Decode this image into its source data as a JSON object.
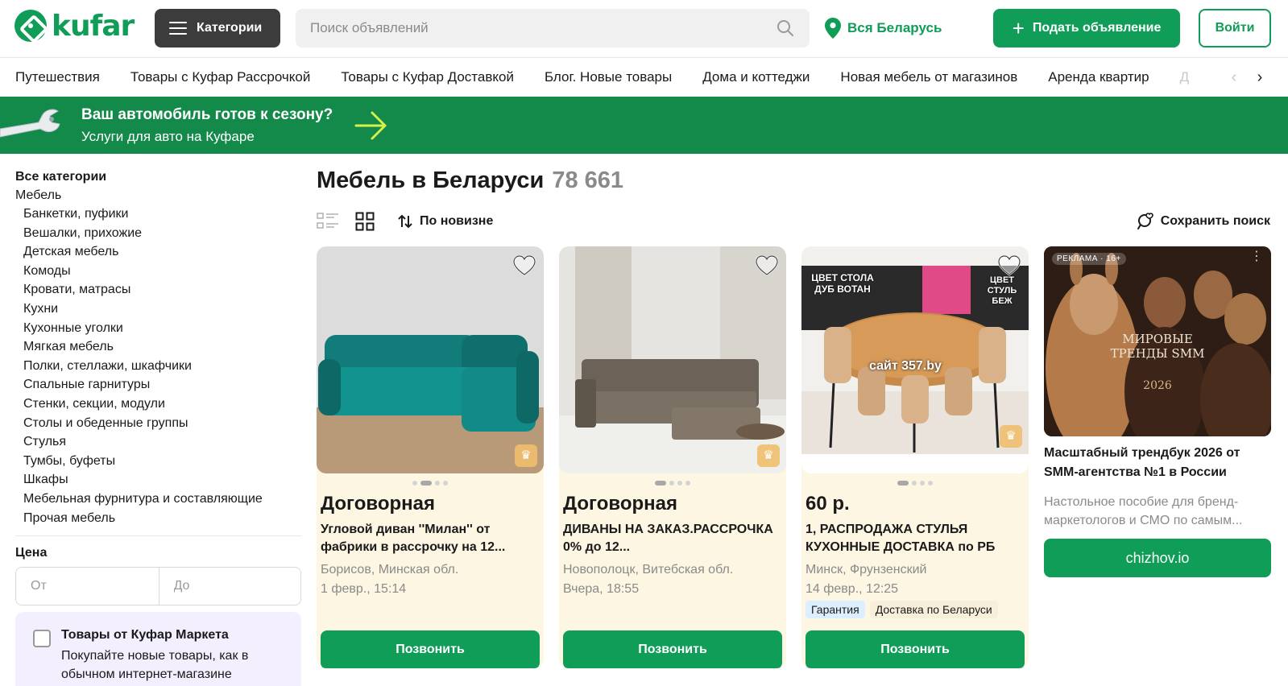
{
  "header": {
    "logo_text": "kufar",
    "categories_label": "Категории",
    "search_placeholder": "Поиск объявлений",
    "region": "Вся Беларусь",
    "post_label": "Подать объявление",
    "login_label": "Войти"
  },
  "nav": {
    "items": [
      "Путешествия",
      "Товары с Куфар Рассрочкой",
      "Товары с Куфар Доставкой",
      "Блог. Новые товары",
      "Дома и коттеджи",
      "Новая мебель от магазинов",
      "Аренда квартир",
      "Д"
    ]
  },
  "banner": {
    "title": "Ваш автомобиль готов к сезону?",
    "subtitle": "Услуги для авто на Куфаре"
  },
  "sidebar": {
    "all_label": "Все категории",
    "current": "Мебель",
    "subcategories": [
      "Банкетки, пуфики",
      "Вешалки, прихожие",
      "Детская мебель",
      "Комоды",
      "Кровати, матрасы",
      "Кухни",
      "Кухонные уголки",
      "Мягкая мебель",
      "Полки, стеллажи, шкафчики",
      "Спальные гарнитуры",
      "Стенки, секции, модули",
      "Столы и обеденные группы",
      "Стулья",
      "Тумбы, буфеты",
      "Шкафы",
      "Мебельная фурнитура и составляющие",
      "Прочая мебель"
    ],
    "price_label": "Цена",
    "price_from_placeholder": "От",
    "price_to_placeholder": "До",
    "market_title": "Товары от Куфар Маркета",
    "market_desc": "Покупайте новые товары, как в обычном интернет-магазине"
  },
  "main": {
    "title": "Мебель в Беларуси",
    "count": "78 661",
    "sort_label": "По новизне",
    "save_search_label": "Сохранить поиск"
  },
  "listings": [
    {
      "price": "Договорная",
      "title": "Угловой диван ''Милан'' от фабрики в рассрочку на 12...",
      "location": "Борисов, Минская обл.",
      "date": "1 февр., 15:14",
      "tags": [],
      "call_label": "Позвонить"
    },
    {
      "price": "Договорная",
      "title": "ДИВАНЫ НА ЗАКАЗ.РАССРОЧКА 0% до 12...",
      "location": "Новополоцк, Витебская обл.",
      "date": "Вчера, 18:55",
      "tags": [],
      "call_label": "Позвонить"
    },
    {
      "price": "60 р.",
      "title": "1, РАСПРОДАЖА СТУЛЬЯ КУХОННЫЕ ДОСТАВКА по РБ",
      "location": "Минск, Фрунзенский",
      "date": "14 февр., 12:25",
      "tags": [
        "Гарантия",
        "Доставка по Беларуси"
      ],
      "call_label": "Позвонить",
      "image_text": {
        "left": "ЦВЕТ СТОЛА ДУБ ВОТАН",
        "right": "ЦВЕТ СТУЛЬ БЕЖ",
        "center": "сайт 357.by"
      }
    }
  ],
  "ad": {
    "badge": "РЕКЛАМА · 16+",
    "image_title": "МИРОВЫЕ ТРЕНДЫ SMM",
    "image_year": "2026",
    "title": "Масштабный трендбук 2026 от SMM-агентства №1 в России",
    "desc": "Настольное пособие для бренд-маркетологов и СМО по самым...",
    "button_label": "chizhov.io"
  },
  "colors": {
    "brand_green": "#0f9d58",
    "banner_green": "#138a4a",
    "card_bg": "#fdf6e3",
    "dark_button": "#3c3c3c"
  },
  "icons": [
    "logo-icon",
    "menu-icon",
    "search-icon",
    "location-pin-icon",
    "plus-icon",
    "wrench-icon",
    "arrow-right-icon",
    "list-view-icon",
    "grid-view-icon",
    "sort-icon",
    "save-search-icon",
    "heart-icon",
    "crown-icon",
    "chevron-left-icon",
    "chevron-right-icon"
  ]
}
